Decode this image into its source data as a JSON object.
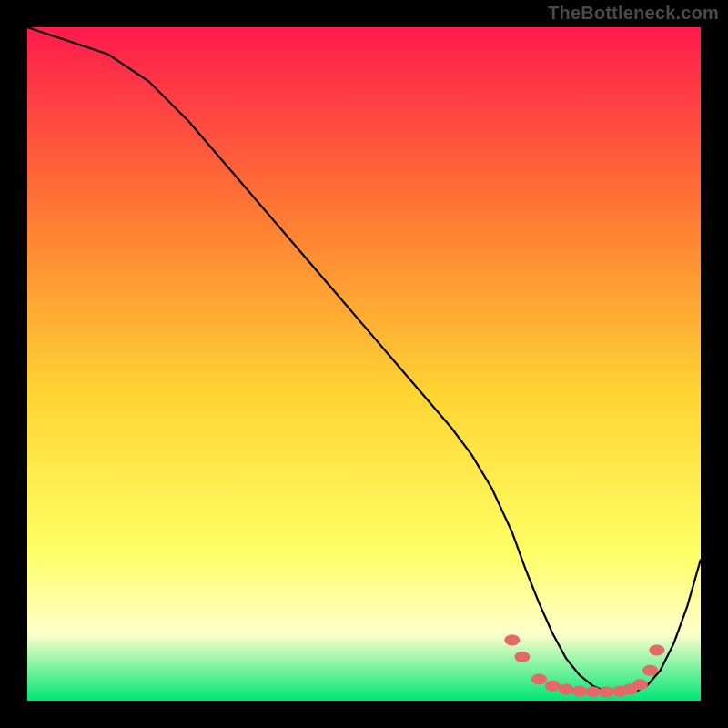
{
  "watermark": "TheBottleneck.com",
  "colors": {
    "bg": "#000000",
    "gradient_top": "#ff1a4d",
    "gradient_mid_upper": "#ff7a33",
    "gradient_mid": "#ffd633",
    "gradient_lower": "#ffff66",
    "gradient_pale": "#ffffcc",
    "gradient_bottom": "#00e676",
    "curve": "#000000",
    "marker_fill": "#e46a6a",
    "marker_stroke": "#c94f4f"
  },
  "chart_data": {
    "type": "line",
    "title": "",
    "xlabel": "",
    "ylabel": "",
    "xlim": [
      0,
      100
    ],
    "ylim": [
      0,
      100
    ],
    "series": [
      {
        "name": "bottleneck-curve",
        "x": [
          0,
          3,
          6,
          9,
          12,
          15,
          18,
          21,
          24,
          27,
          30,
          33,
          36,
          39,
          42,
          45,
          48,
          51,
          54,
          57,
          60,
          63,
          66,
          69,
          72,
          74,
          76,
          78,
          80,
          82,
          84,
          86,
          88,
          90,
          92,
          94,
          96,
          98,
          100
        ],
        "y": [
          100,
          99,
          98,
          97,
          96,
          94,
          92,
          89,
          86,
          82.5,
          79,
          75.5,
          72,
          68.5,
          65,
          61.5,
          58,
          54.5,
          51,
          47.5,
          44,
          40.5,
          36.5,
          31.5,
          25,
          19.5,
          14.5,
          10,
          6.3,
          3.8,
          2.2,
          1.3,
          1.0,
          1.2,
          2.2,
          4.5,
          8.5,
          14,
          21
        ]
      }
    ],
    "markers": {
      "name": "highlight-dots",
      "points": [
        {
          "x": 72.0,
          "y": 9.0
        },
        {
          "x": 73.5,
          "y": 6.5
        },
        {
          "x": 76.0,
          "y": 3.2
        },
        {
          "x": 78.0,
          "y": 2.2
        },
        {
          "x": 80.0,
          "y": 1.7
        },
        {
          "x": 82.0,
          "y": 1.4
        },
        {
          "x": 84.0,
          "y": 1.3
        },
        {
          "x": 86.0,
          "y": 1.3
        },
        {
          "x": 88.0,
          "y": 1.4
        },
        {
          "x": 89.5,
          "y": 1.7
        },
        {
          "x": 91.0,
          "y": 2.4
        },
        {
          "x": 92.5,
          "y": 4.5
        },
        {
          "x": 93.5,
          "y": 7.5
        }
      ]
    }
  }
}
